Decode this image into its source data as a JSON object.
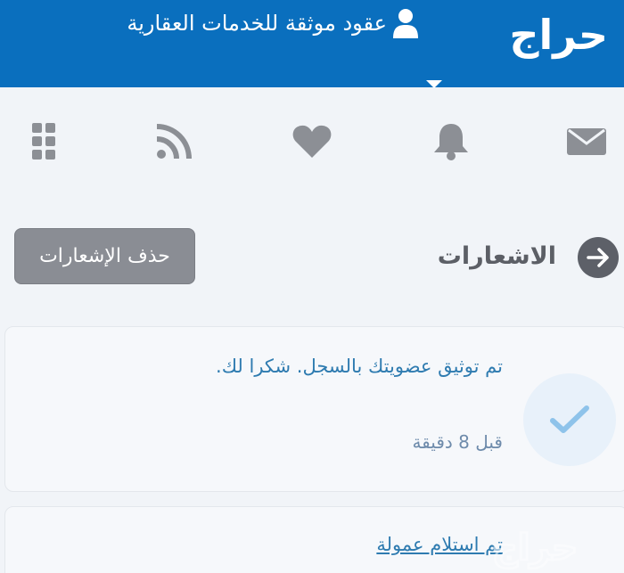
{
  "header": {
    "logo_text": "حراج",
    "account_label": "عقود موثقة للخدمات العقارية",
    "account_icon": "user-icon",
    "brand_color": "#0a6fbe"
  },
  "nav_icons": [
    "envelope-icon",
    "bell-icon",
    "heart-icon",
    "rss-icon",
    "grid-icon"
  ],
  "page": {
    "title": "الاشعارات",
    "back_icon": "arrow-right-icon",
    "delete_button_label": "حذف الإشعارات"
  },
  "notifications": [
    {
      "text": "تم توثيق عضويتك بالسجل. شكرا لك.",
      "time": "قبل 8 دقيقة",
      "status_icon": "check-icon"
    },
    {
      "text": "تم استلام عمولة"
    }
  ],
  "watermark": {
    "text": "حراج"
  }
}
